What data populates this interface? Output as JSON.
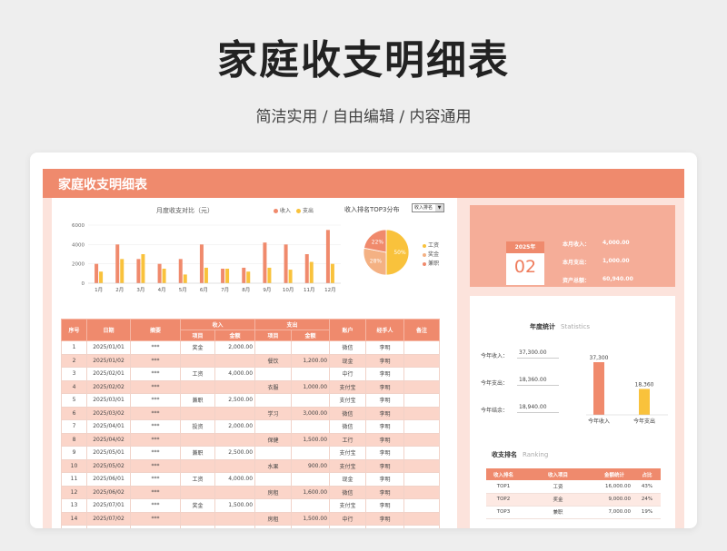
{
  "hero": {
    "title": "家庭收支明细表",
    "subtitle": "简洁实用 / 自由编辑 / 内容通用"
  },
  "sheet": {
    "title": "家庭收支明细表"
  },
  "colors": {
    "accent": "#ef8a6d",
    "income": "#f08a6c",
    "expense": "#f9c23c",
    "other": "#f4b183"
  },
  "chart_data": [
    {
      "type": "bar",
      "title": "月度收支对比（元）",
      "categories": [
        "1月",
        "2月",
        "3月",
        "4月",
        "5月",
        "6月",
        "7月",
        "8月",
        "9月",
        "10月",
        "11月",
        "12月"
      ],
      "yticks": [
        "0",
        "2000",
        "4000",
        "6000"
      ],
      "ylim": [
        0,
        6000
      ],
      "series": [
        {
          "name": "收入",
          "values": [
            2000,
            4000,
            2500,
            2000,
            2500,
            4000,
            1500,
            1600,
            4200,
            4000,
            3000,
            5500
          ]
        },
        {
          "name": "支出",
          "values": [
            1200,
            2500,
            3000,
            1500,
            900,
            1600,
            1500,
            1200,
            1600,
            1400,
            2200,
            2000
          ]
        }
      ],
      "legend": "top-right"
    },
    {
      "type": "pie",
      "title": "收入排名TOP3分布",
      "categories": [
        "工资",
        "奖金",
        "兼职"
      ],
      "values": [
        50,
        28,
        22
      ],
      "labels": [
        "50%",
        "28%",
        "22%"
      ]
    },
    {
      "type": "bar",
      "categories": [
        "今年收入",
        "今年支出"
      ],
      "values": [
        37300,
        18360
      ],
      "labels": [
        "37,300",
        "18,360"
      ]
    }
  ],
  "pie_select": "收入排名",
  "table": {
    "headers": [
      "序号",
      "日期",
      "摘要",
      "收入",
      "支出",
      "账户",
      "经手人",
      "备注"
    ],
    "subheaders": [
      "项目",
      "金额",
      "项目",
      "金额"
    ],
    "rows": [
      [
        "1",
        "2025/01/01",
        "***",
        "奖金",
        "2,000.00",
        "",
        "",
        "微信",
        "李明",
        ""
      ],
      [
        "2",
        "2025/01/02",
        "***",
        "",
        "",
        "餐饮",
        "1,200.00",
        "现金",
        "李明",
        ""
      ],
      [
        "3",
        "2025/02/01",
        "***",
        "工资",
        "4,000.00",
        "",
        "",
        "中行",
        "李明",
        ""
      ],
      [
        "4",
        "2025/02/02",
        "***",
        "",
        "",
        "衣服",
        "1,000.00",
        "支付宝",
        "李明",
        ""
      ],
      [
        "5",
        "2025/03/01",
        "***",
        "兼职",
        "2,500.00",
        "",
        "",
        "支付宝",
        "李明",
        ""
      ],
      [
        "6",
        "2025/03/02",
        "***",
        "",
        "",
        "学习",
        "3,000.00",
        "微信",
        "李明",
        ""
      ],
      [
        "7",
        "2025/04/01",
        "***",
        "投资",
        "2,000.00",
        "",
        "",
        "微信",
        "李明",
        ""
      ],
      [
        "8",
        "2025/04/02",
        "***",
        "",
        "",
        "保健",
        "1,500.00",
        "工行",
        "李明",
        ""
      ],
      [
        "9",
        "2025/05/01",
        "***",
        "兼职",
        "2,500.00",
        "",
        "",
        "支付宝",
        "李明",
        ""
      ],
      [
        "10",
        "2025/05/02",
        "***",
        "",
        "",
        "水果",
        "900.00",
        "支付宝",
        "李明",
        ""
      ],
      [
        "11",
        "2025/06/01",
        "***",
        "工资",
        "4,000.00",
        "",
        "",
        "现金",
        "李明",
        ""
      ],
      [
        "12",
        "2025/06/02",
        "***",
        "",
        "",
        "房租",
        "1,600.00",
        "微信",
        "李明",
        ""
      ],
      [
        "13",
        "2025/07/01",
        "***",
        "奖金",
        "1,500.00",
        "",
        "",
        "支付宝",
        "李明",
        ""
      ],
      [
        "14",
        "2025/07/02",
        "***",
        "",
        "",
        "房租",
        "1,500.00",
        "中行",
        "李明",
        ""
      ],
      [
        "15",
        "2025/08/01",
        "***",
        "",
        "",
        "房租",
        "1,600.00",
        "工行",
        "李明",
        ""
      ],
      [
        "16",
        "2025/08/02",
        "***",
        "",
        "",
        "购物",
        "1,200.00",
        "现金",
        "李明",
        ""
      ]
    ]
  },
  "calendar": {
    "year": "2025年",
    "day": "02"
  },
  "month_stats": [
    {
      "label": "本月收入：",
      "value": "4,000.00"
    },
    {
      "label": "本月支出：",
      "value": "1,000.00"
    },
    {
      "label": "资产总额：",
      "value": "60,940.00"
    }
  ],
  "annual": {
    "title": "年度统计",
    "subtitle": "Statistics",
    "rows": [
      {
        "label": "今年收入：",
        "value": "37,300.00"
      },
      {
        "label": "今年支出：",
        "value": "18,360.00"
      },
      {
        "label": "今年结余：",
        "value": "18,940.00"
      }
    ]
  },
  "ranking": {
    "title": "收支排名",
    "subtitle": "Ranking",
    "headers": [
      "收入排名",
      "收入项目",
      "金额统计",
      "占比"
    ],
    "rows": [
      [
        "TOP1",
        "工资",
        "16,000.00",
        "43%"
      ],
      [
        "TOP2",
        "奖金",
        "9,000.00",
        "24%"
      ],
      [
        "TOP3",
        "兼职",
        "7,000.00",
        "19%"
      ]
    ]
  }
}
